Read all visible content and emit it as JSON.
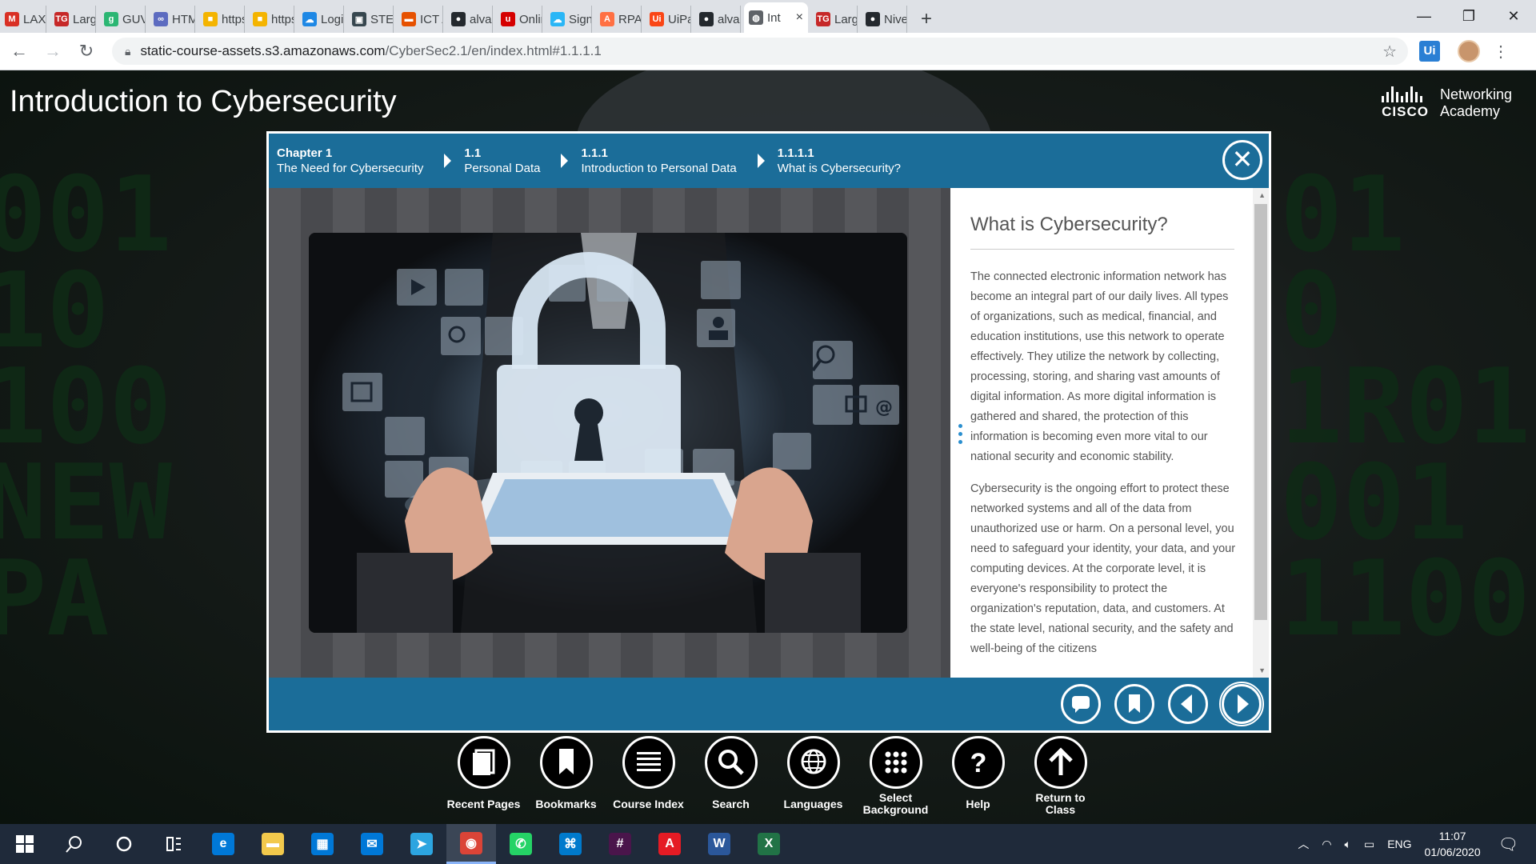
{
  "browser": {
    "tabs": [
      {
        "label": "LAXM",
        "color": "#d93025",
        "glyph": "M"
      },
      {
        "label": "Large",
        "color": "#c62828",
        "glyph": "TG"
      },
      {
        "label": "GUVI",
        "color": "#2bb673",
        "glyph": "g"
      },
      {
        "label": "HTML",
        "color": "#5c6bc0",
        "glyph": "∞"
      },
      {
        "label": "https:",
        "color": "#f4b400",
        "glyph": "■"
      },
      {
        "label": "https:",
        "color": "#f4b400",
        "glyph": "■"
      },
      {
        "label": "Login",
        "color": "#1e88e5",
        "glyph": "☁"
      },
      {
        "label": "STEP",
        "color": "#37474f",
        "glyph": "▣"
      },
      {
        "label": "ICT A",
        "color": "#e65100",
        "glyph": "▬"
      },
      {
        "label": "alvas-",
        "color": "#24292e",
        "glyph": "●"
      },
      {
        "label": "Onlin",
        "color": "#d50000",
        "glyph": "u"
      },
      {
        "label": "Sign i",
        "color": "#29b6f6",
        "glyph": "☁"
      },
      {
        "label": "RPA C",
        "color": "#ff7043",
        "glyph": "A"
      },
      {
        "label": "UiPat",
        "color": "#fa4616",
        "glyph": "Ui"
      },
      {
        "label": "alvas-",
        "color": "#24292e",
        "glyph": "●"
      },
      {
        "label": "Int",
        "color": "#5f6368",
        "glyph": "◍",
        "active": true
      },
      {
        "label": "Large",
        "color": "#c62828",
        "glyph": "TG"
      },
      {
        "label": "Nived",
        "color": "#24292e",
        "glyph": "●"
      }
    ],
    "close_tab": "×",
    "new_tab": "+",
    "url_host": "static-course-assets.s3.amazonaws.com",
    "url_path": "/CyberSec2.1/en/index.html#1.1.1.1",
    "ext_label": "Ui"
  },
  "page": {
    "course_title": "Introduction to Cybersecurity",
    "cisco_word": "CISCO",
    "academy_line1": "Networking",
    "academy_line2": "Academy"
  },
  "breadcrumb": [
    {
      "num": "Chapter 1",
      "title": "The Need for Cybersecurity"
    },
    {
      "num": "1.1",
      "title": "Personal Data"
    },
    {
      "num": "1.1.1",
      "title": "Introduction to Personal Data"
    },
    {
      "num": "1.1.1.1",
      "title": "What is Cybersecurity?"
    }
  ],
  "content": {
    "heading": "What is Cybersecurity?",
    "paragraphs": [
      "The connected electronic information network has become an integral part of our daily lives. All types of organizations, such as medical, financial, and education institutions, use this network to operate effectively. They utilize the network by collecting, processing, storing, and sharing vast amounts of digital information. As more digital information is gathered and shared, the protection of this information is becoming even more vital to our national security and economic stability.",
      "Cybersecurity is the ongoing effort to protect these networked systems and all of the data from unauthorized use or harm. On a personal level, you need to safeguard your identity, your data, and your computing devices. At the corporate level, it is everyone's responsibility to protect the organization's reputation, data, and customers. At the state level, national security, and the safety and well-being of the citizens"
    ]
  },
  "toolbar": [
    {
      "label": "Recent Pages",
      "icon": "pages-icon"
    },
    {
      "label": "Bookmarks",
      "icon": "bookmark-icon"
    },
    {
      "label": "Course Index",
      "icon": "menu-icon"
    },
    {
      "label": "Search",
      "icon": "search-icon"
    },
    {
      "label": "Languages",
      "icon": "globe-icon"
    },
    {
      "label": "Select Background",
      "icon": "grid-icon"
    },
    {
      "label": "Help",
      "icon": "help-icon"
    },
    {
      "label": "Return to Class",
      "icon": "arrow-up-icon"
    }
  ],
  "taskbar": {
    "apps": [
      {
        "name": "edge",
        "color": "#0078d7",
        "glyph": "e"
      },
      {
        "name": "file-explorer",
        "color": "#f2c94c",
        "glyph": "▬"
      },
      {
        "name": "store",
        "color": "#0078d7",
        "glyph": "▦"
      },
      {
        "name": "mail",
        "color": "#0078d7",
        "glyph": "✉"
      },
      {
        "name": "telegram",
        "color": "#2ca5e0",
        "glyph": "➤"
      },
      {
        "name": "chrome",
        "color": "#db4437",
        "glyph": "◉",
        "active": true
      },
      {
        "name": "whatsapp",
        "color": "#25d366",
        "glyph": "✆"
      },
      {
        "name": "vscode",
        "color": "#007acc",
        "glyph": "⌘"
      },
      {
        "name": "slack",
        "color": "#4a154b",
        "glyph": "#"
      },
      {
        "name": "acrobat",
        "color": "#e51b24",
        "glyph": "A"
      },
      {
        "name": "word",
        "color": "#2b579a",
        "glyph": "W"
      },
      {
        "name": "excel",
        "color": "#217346",
        "glyph": "X"
      }
    ],
    "language": "ENG",
    "time": "11:07",
    "date": "01/06/2020"
  }
}
